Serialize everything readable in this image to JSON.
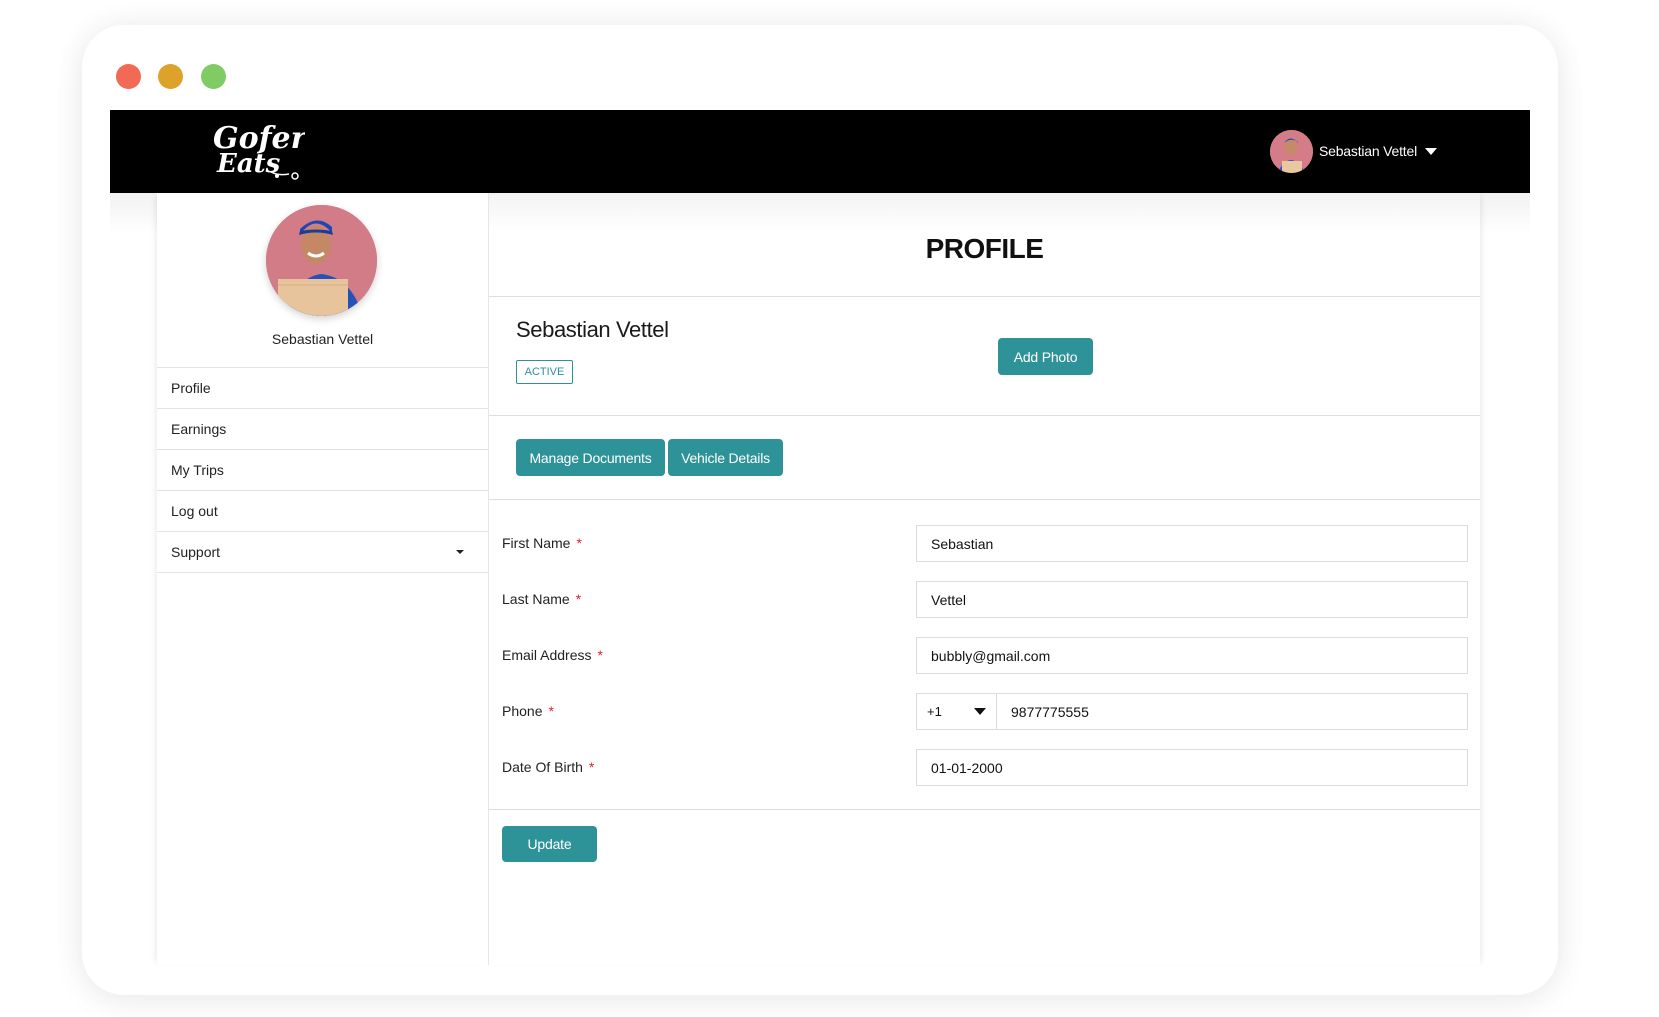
{
  "window": {
    "controls": [
      "close",
      "minimize",
      "maximize"
    ],
    "colors": {
      "close": "#f26a55",
      "minimize": "#dda22a",
      "maximize": "#80cc64"
    }
  },
  "navbar": {
    "logo_alt": "Gofer Eats",
    "logo_line1": "Gofer",
    "logo_line2": "Eats",
    "user_name": "Sebastian Vettel",
    "user_menu_icon": "caret-down-icon"
  },
  "sidebar": {
    "user_name": "Sebastian Vettel",
    "items": [
      {
        "label": "Profile"
      },
      {
        "label": "Earnings"
      },
      {
        "label": "My Trips"
      },
      {
        "label": "Log out"
      },
      {
        "label": "Support",
        "icon": "caret-down-icon"
      }
    ]
  },
  "main": {
    "title": "PROFILE",
    "profile_name": "Sebastian Vettel",
    "status": "ACTIVE",
    "add_photo_label": "Add Photo",
    "manage_documents_label": "Manage Documents",
    "vehicle_details_label": "Vehicle Details",
    "form": {
      "first_name": {
        "label": "First Name",
        "required": "*",
        "value": "Sebastian"
      },
      "last_name": {
        "label": "Last Name",
        "required": "*",
        "value": "Vettel"
      },
      "email": {
        "label": "Email Address",
        "required": "*",
        "value": "bubbly@gmail.com"
      },
      "phone": {
        "label": "Phone",
        "required": "*",
        "country_code": "+1",
        "value": "9877775555"
      },
      "dob": {
        "label": "Date Of Birth",
        "required": "*",
        "value": "01-01-2000"
      }
    },
    "update_label": "Update"
  },
  "colors": {
    "accent": "#2e9399",
    "navbar": "#000000",
    "required": "#e0202a"
  }
}
